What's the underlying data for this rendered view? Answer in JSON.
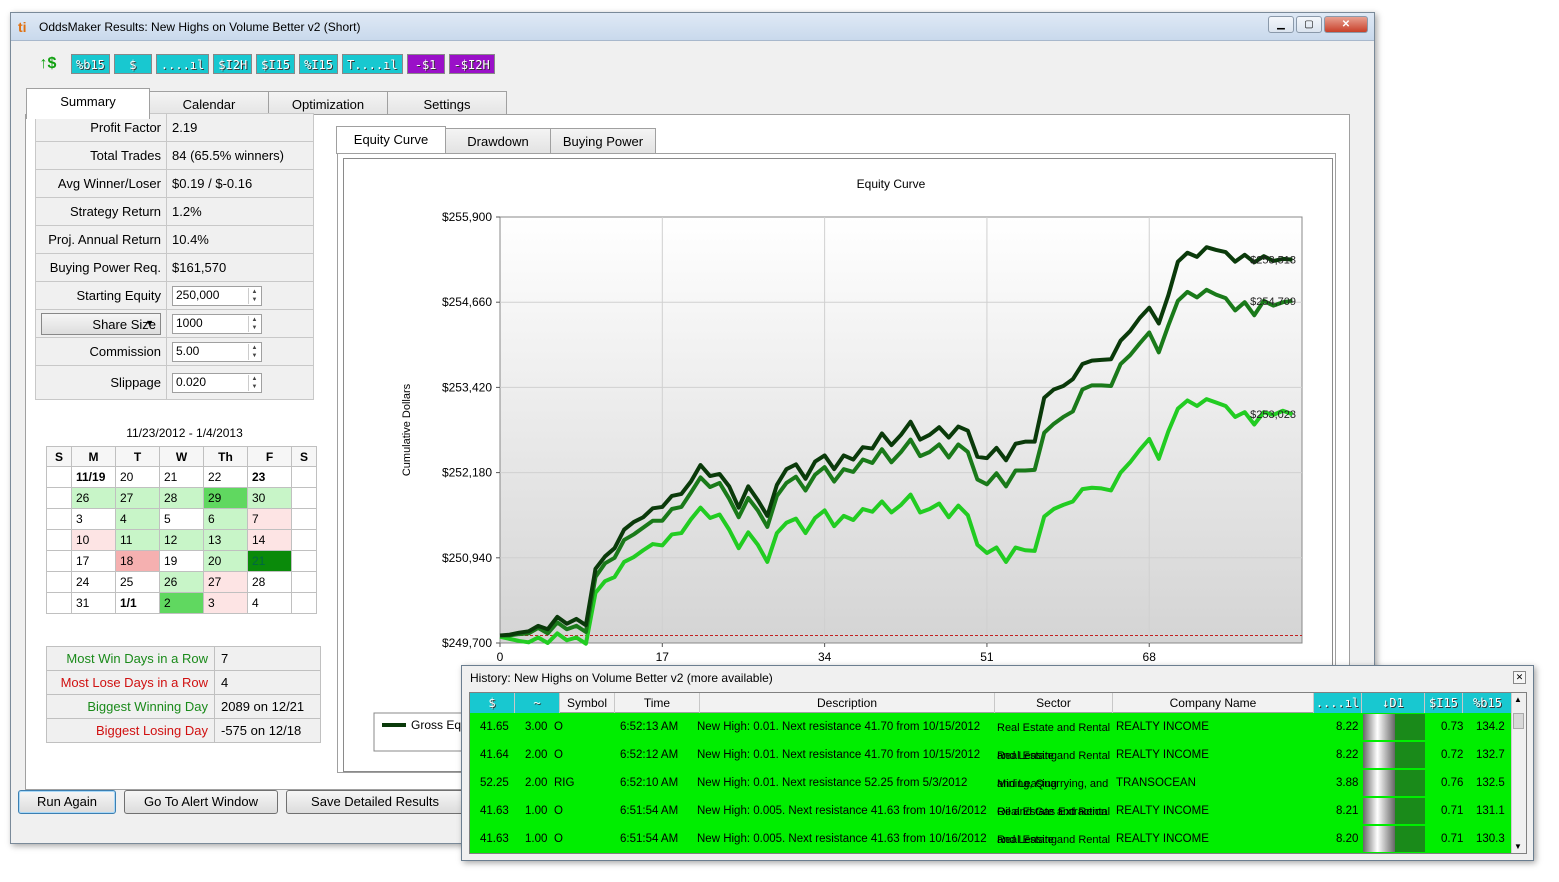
{
  "window": {
    "title": "OddsMaker Results: New Highs on Volume Better v2 (Short)",
    "logo_text": "ti"
  },
  "toolbar": [
    {
      "label": "↑$",
      "style": "money"
    },
    {
      "label": "%b15",
      "style": "cyan"
    },
    {
      "label": "$",
      "style": "cyan"
    },
    {
      "label": "....ıl",
      "style": "cyan"
    },
    {
      "label": "$I2H",
      "style": "cyan"
    },
    {
      "label": "$I15",
      "style": "cyan"
    },
    {
      "label": "%I15",
      "style": "cyan"
    },
    {
      "label": "T....ıl",
      "style": "cyan"
    },
    {
      "label": "-$1",
      "style": "purple"
    },
    {
      "label": "-$I2H",
      "style": "purple"
    }
  ],
  "tabs": [
    "Summary",
    "Calendar",
    "Optimization",
    "Settings"
  ],
  "stats": [
    {
      "label": "Profit Factor",
      "value": "2.19"
    },
    {
      "label": "Total Trades",
      "value": "84 (65.5% winners)"
    },
    {
      "label": "Avg Winner/Loser",
      "value": "$0.19 / $-0.16"
    },
    {
      "label": "Strategy Return",
      "value": "1.2%"
    },
    {
      "label": "Proj. Annual Return",
      "value": "10.4%"
    },
    {
      "label": "Buying Power Req.",
      "value": "$161,570"
    }
  ],
  "inputs": {
    "starting_equity_label": "Starting Equity",
    "starting_equity": "250,000",
    "share_size_option": "Share Size",
    "share_size": "1000",
    "commission_label": "Commission",
    "commission": "5.00",
    "slippage_label": "Slippage",
    "slippage": "0.020"
  },
  "calendar": {
    "range": "11/23/2012 - 1/4/2013",
    "headers": [
      "S",
      "M",
      "T",
      "W",
      "Th",
      "F",
      "S"
    ],
    "weeks": [
      [
        "",
        "11/19",
        "20",
        "21",
        "22",
        "23",
        ""
      ],
      [
        "",
        "26",
        "27",
        "28",
        "29",
        "30",
        ""
      ],
      [
        "",
        "3",
        "4",
        "5",
        "6",
        "7",
        ""
      ],
      [
        "",
        "10",
        "11",
        "12",
        "13",
        "14",
        ""
      ],
      [
        "",
        "17",
        "18",
        "19",
        "20",
        "21",
        ""
      ],
      [
        "",
        "24",
        "25",
        "26",
        "27",
        "28",
        ""
      ],
      [
        "",
        "31",
        "1/1",
        "2",
        "3",
        "4",
        ""
      ]
    ],
    "shading": [
      [
        "",
        "",
        "",
        "",
        "",
        "",
        ""
      ],
      [
        "",
        "g1",
        "g1",
        "g1",
        "g3",
        "g1",
        ""
      ],
      [
        "",
        "",
        "g1",
        "",
        "g1",
        "r1",
        ""
      ],
      [
        "",
        "r1",
        "g1",
        "g1",
        "g1",
        "r1",
        ""
      ],
      [
        "",
        "",
        "r2",
        "",
        "g1",
        "g4",
        ""
      ],
      [
        "",
        "",
        "",
        "g1",
        "r1",
        "",
        ""
      ],
      [
        "",
        "",
        "",
        "g3",
        "r1",
        "",
        ""
      ]
    ],
    "bold_cells": [
      "11/19",
      "23",
      "1/1"
    ]
  },
  "streaks": [
    {
      "label": "Most Win Days in a Row",
      "value": "7",
      "color": "#1a8a1a"
    },
    {
      "label": "Most Lose Days in a Row",
      "value": "4",
      "color": "#d01010"
    },
    {
      "label": "Biggest Winning Day",
      "value": "2089 on 12/21",
      "color": "#1a8a1a"
    },
    {
      "label": "Biggest Losing Day",
      "value": "-575 on 12/18",
      "color": "#d01010"
    }
  ],
  "buttons": [
    "Run Again",
    "Go To Alert Window",
    "Save Detailed Results"
  ],
  "chart_tabs": [
    "Equity Curve",
    "Drawdown",
    "Buying Power"
  ],
  "chart_data": {
    "type": "line",
    "title": "Equity Curve",
    "ylabel": "Cumulative Dollars",
    "xlabel": "",
    "xlim": [
      0,
      84
    ],
    "ylim": [
      249700,
      255900
    ],
    "yticks": [
      "$255,900",
      "$254,660",
      "$253,420",
      "$252,180",
      "$250,940",
      "$249,700"
    ],
    "xticks": [
      "0",
      "17",
      "34",
      "51",
      "68"
    ],
    "legend_visible": "Gross Equ",
    "colors": [
      "#0a3a0a",
      "#1a7a1a",
      "#22cc22"
    ],
    "series": [
      {
        "name": "Gross Equ",
        "end_label": "$253,513",
        "values": [
          249810,
          249820,
          249850,
          249870,
          249950,
          249900,
          250080,
          249980,
          250050,
          249960,
          250780,
          250960,
          251080,
          251350,
          251460,
          251530,
          251660,
          251680,
          251840,
          251870,
          252050,
          252290,
          252130,
          252160,
          251980,
          251670,
          251980,
          251780,
          251550,
          252000,
          252230,
          252300,
          252090,
          252340,
          252430,
          252230,
          252430,
          252370,
          252550,
          252530,
          252750,
          252580,
          252730,
          252920,
          252660,
          252730,
          252840,
          252690,
          252850,
          252790,
          252410,
          252390,
          252540,
          252360,
          252600,
          252630,
          252630,
          253270,
          253390,
          253440,
          253540,
          253760,
          253810,
          253820,
          253830,
          254100,
          254240,
          254430,
          254580,
          254350,
          254760,
          255250,
          255380,
          255320,
          255460,
          255420,
          255390,
          255250,
          255350,
          255240,
          255330,
          255260,
          255290,
          255280
        ]
      },
      {
        "name": "",
        "end_label": "$254,709",
        "values": [
          249810,
          249810,
          249830,
          249840,
          249920,
          249840,
          250000,
          249900,
          249950,
          249860,
          250660,
          250860,
          250940,
          251200,
          251280,
          251380,
          251480,
          251480,
          251650,
          251680,
          251890,
          252110,
          251970,
          252030,
          251800,
          251530,
          251810,
          251630,
          251390,
          251840,
          252030,
          252120,
          251920,
          252150,
          252260,
          252050,
          252230,
          252190,
          252370,
          252320,
          252520,
          252330,
          252480,
          252660,
          252420,
          252480,
          252590,
          252400,
          252590,
          252480,
          252080,
          252010,
          252170,
          251980,
          252210,
          252210,
          252220,
          252760,
          252890,
          252990,
          253070,
          253390,
          253450,
          253450,
          253440,
          253760,
          253890,
          254060,
          254220,
          253930,
          254320,
          254680,
          254810,
          254730,
          254840,
          254770,
          254720,
          254540,
          254660,
          254470,
          254680,
          254610,
          254660,
          254680
        ]
      },
      {
        "name": "",
        "end_label": "$253,023",
        "values": [
          249790,
          249760,
          249730,
          249710,
          249780,
          249700,
          249840,
          249740,
          249780,
          249690,
          250430,
          250600,
          250660,
          250880,
          250950,
          251050,
          251140,
          251120,
          251280,
          251300,
          251500,
          251670,
          251520,
          251570,
          251350,
          251080,
          251310,
          251130,
          250880,
          251300,
          251450,
          251510,
          251300,
          251520,
          251630,
          251400,
          251550,
          251490,
          251650,
          251610,
          251760,
          251600,
          251710,
          251860,
          251600,
          251650,
          251730,
          251530,
          251700,
          251560,
          251130,
          251010,
          251090,
          250880,
          251090,
          251050,
          251040,
          251540,
          251650,
          251710,
          251760,
          251940,
          251960,
          251950,
          251920,
          252180,
          252330,
          252510,
          252670,
          252380,
          252780,
          253110,
          253230,
          253150,
          253250,
          253200,
          253150,
          252990,
          253060,
          252880,
          253060,
          253020,
          253080,
          253030
        ]
      }
    ],
    "baseline": 249810
  },
  "history": {
    "title": "History:  New Highs on Volume Better v2  (more available)",
    "columns": [
      "$",
      "~",
      "Symbol",
      "Time",
      "Description",
      "Sector",
      "Company Name",
      "....ıl",
      "↓D1",
      "$I15",
      "%b15"
    ],
    "rows": [
      {
        "price": "41.65",
        "qty": "3.00",
        "symbol": "O",
        "time": "6:52:13 AM",
        "desc": "New High: 0.01. Next resistance 41.70 from 10/15/2012",
        "sector1": "Real Estate and Rental",
        "sector2": "and Leasing",
        "company": "REALTY INCOME",
        "vol": "8.22",
        "i15": "0.73",
        "b15": "134.2"
      },
      {
        "price": "41.64",
        "qty": "2.00",
        "symbol": "O",
        "time": "6:52:12 AM",
        "desc": "New High: 0.01. Next resistance 41.70 from 10/15/2012",
        "sector1": "Real Estate and Rental",
        "sector2": "and Leasing",
        "company": "REALTY INCOME",
        "vol": "8.22",
        "i15": "0.72",
        "b15": "132.7"
      },
      {
        "price": "52.25",
        "qty": "2.00",
        "symbol": "RIG",
        "time": "6:52:10 AM",
        "desc": "New High: 0.01. Next resistance 52.25 from 5/3/2012",
        "sector1": "Mining, Quarrying, and",
        "sector2": "Oil and Gas Extraction",
        "company": "TRANSOCEAN",
        "vol": "3.88",
        "i15": "0.76",
        "b15": "132.5"
      },
      {
        "price": "41.63",
        "qty": "1.00",
        "symbol": "O",
        "time": "6:51:54 AM",
        "desc": "New High: 0.005. Next resistance 41.63 from 10/16/2012",
        "sector1": "Real Estate and Rental",
        "sector2": "and Leasing",
        "company": "REALTY INCOME",
        "vol": "8.21",
        "i15": "0.71",
        "b15": "131.1"
      },
      {
        "price": "41.63",
        "qty": "1.00",
        "symbol": "O",
        "time": "6:51:54 AM",
        "desc": "New High: 0.005. Next resistance 41.63 from 10/16/2012",
        "sector1": "Real Estate and Rental",
        "sector2": "and Leasing",
        "company": "REALTY INCOME",
        "vol": "8.20",
        "i15": "0.71",
        "b15": "130.3"
      }
    ]
  }
}
